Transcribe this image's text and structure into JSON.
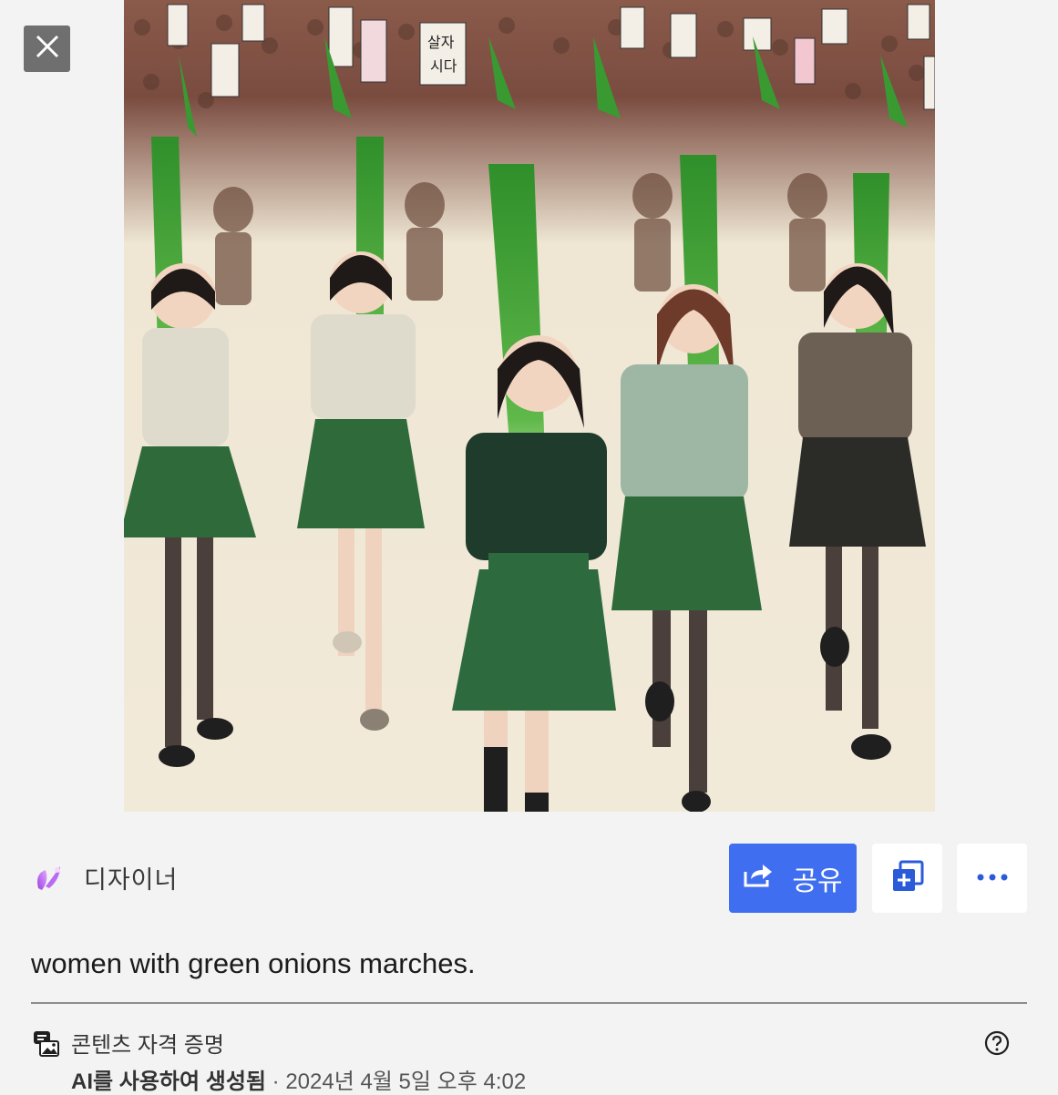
{
  "viewer": {
    "close_label": "Close",
    "close_icon": "close-icon"
  },
  "image": {
    "sign_text_1": "살자",
    "sign_text_2": "시다"
  },
  "app": {
    "name": "디자이너",
    "icon": "designer-logo-icon"
  },
  "actions": {
    "share_label": "공유",
    "share_icon": "share-icon",
    "add_icon": "add-to-collection-icon",
    "more_icon": "more-options-icon"
  },
  "prompt": "women with green onions marches.",
  "credentials": {
    "title": "콘텐츠 자격 증명",
    "generated_label": "AI를 사용하여 생성됨",
    "separator": " · ",
    "timestamp": "2024년 4월 5일 오후 4:02",
    "help_icon": "help-icon"
  },
  "colors": {
    "share_button": "#3f6ef0",
    "background": "#f3f3f3",
    "close_button": "#6f6f6f"
  }
}
